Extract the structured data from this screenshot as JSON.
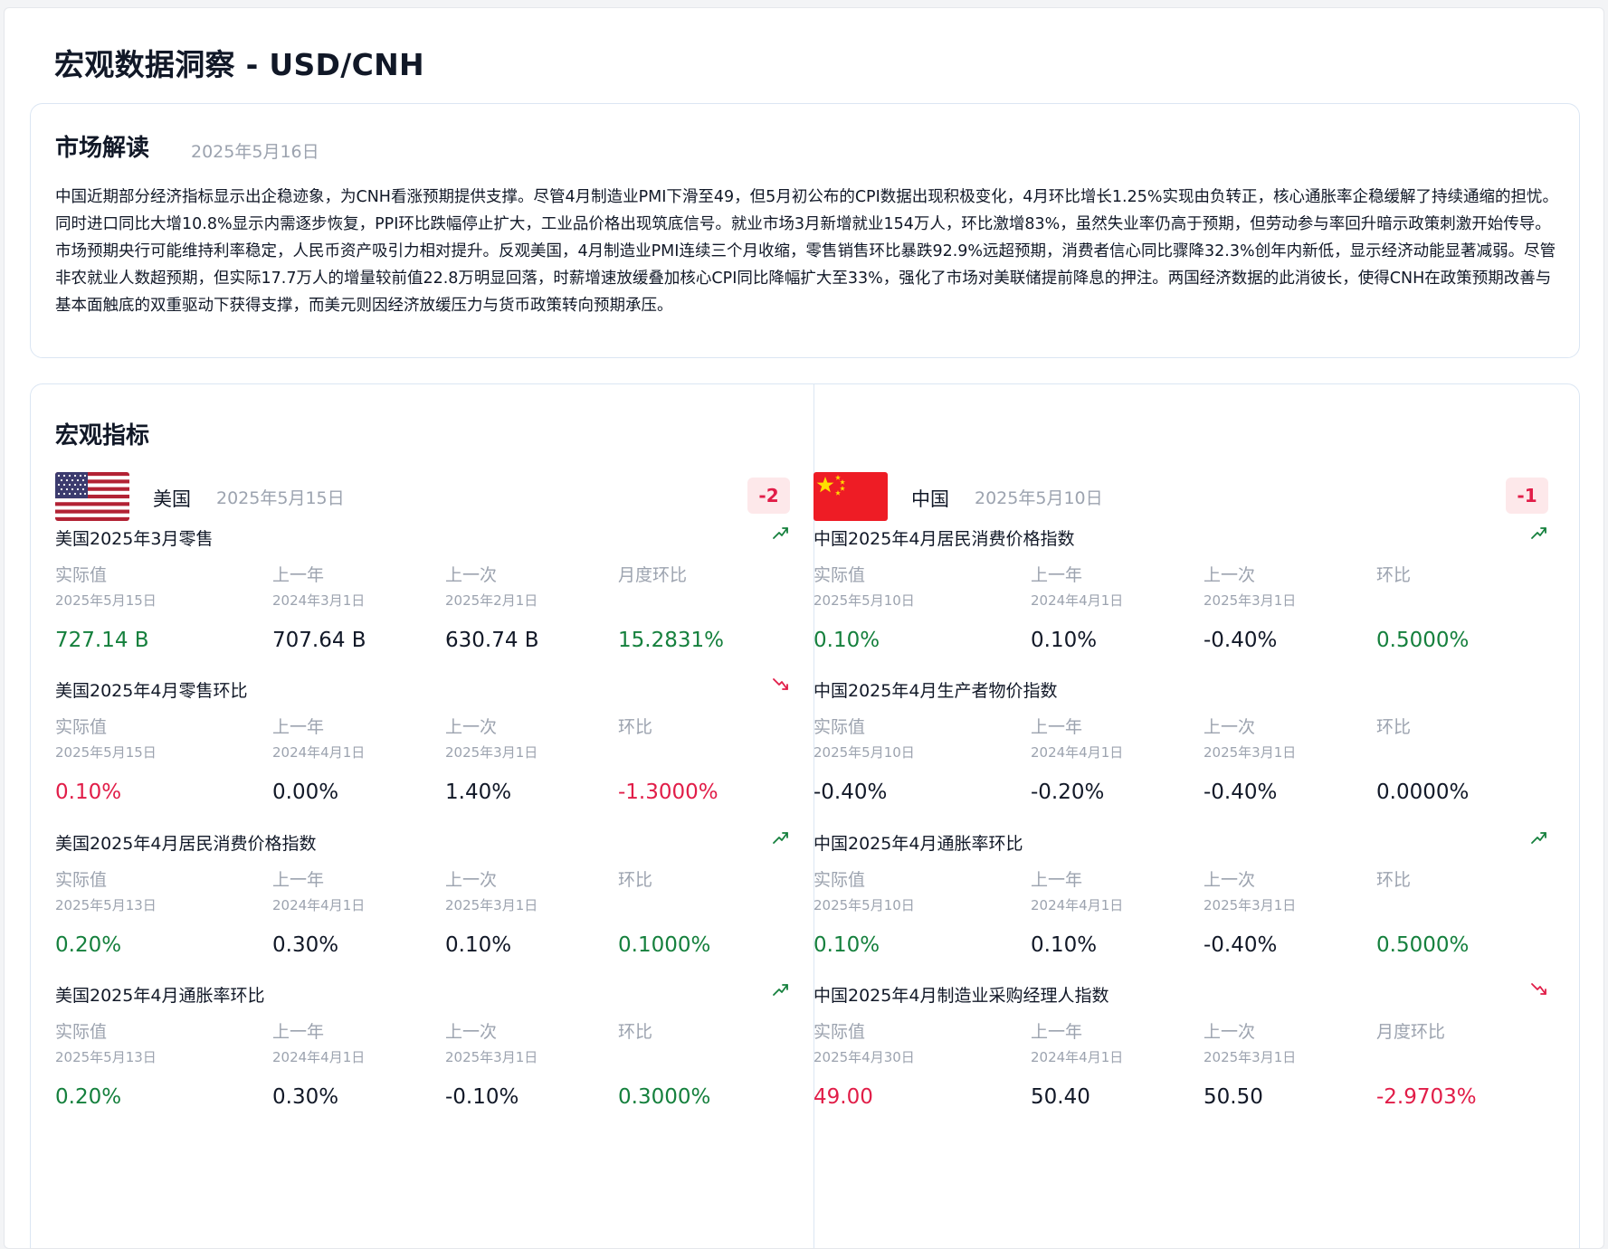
{
  "page": {
    "title": "宏观数据洞察 - USD/CNH"
  },
  "market": {
    "title": "市场解读",
    "date": "2025年5月16日",
    "text": "中国近期部分经济指标显示出企稳迹象，为CNH看涨预期提供支撑。尽管4月制造业PMI下滑至49，但5月初公布的CPI数据出现积极变化，4月环比增长1.25%实现由负转正，核心通胀率企稳缓解了持续通缩的担忧。同时进口同比大增10.8%显示内需逐步恢复，PPI环比跌幅停止扩大，工业品价格出现筑底信号。就业市场3月新增就业154万人，环比激增83%，虽然失业率仍高于预期，但劳动参与率回升暗示政策刺激开始传导。市场预期央行可能维持利率稳定，人民币资产吸引力相对提升。反观美国，4月制造业PMI连续三个月收缩，零售销售环比暴跌92.9%远超预期，消费者信心同比骤降32.3%创年内新低，显示经济动能显著减弱。尽管非农就业人数超预期，但实际17.7万人的增量较前值22.8万明显回落，时薪增速放缓叠加核心CPI同比降幅扩大至33%，强化了市场对美联储提前降息的押注。两国经济数据的此消彼长，使得CNH在政策预期改善与基本面触底的双重驱动下获得支撑，而美元则因经济放缓压力与货币政策转向预期承压。"
  },
  "macro": {
    "title": "宏观指标",
    "us": {
      "name": "美国",
      "flag_icon": "us-flag-icon",
      "date": "2025年5月15日",
      "score": "-2",
      "indicators": [
        {
          "name": "美国2025年3月零售",
          "trend": "up",
          "labels": [
            "实际值",
            "上一年",
            "上一次",
            "月度环比"
          ],
          "dates": [
            "2025年5月15日",
            "2024年3月1日",
            "2025年2月1日",
            ""
          ],
          "values": [
            "727.14 B",
            "707.64 B",
            "630.74 B",
            "15.2831%"
          ],
          "actual_sign": "pos",
          "change_sign": "pos"
        },
        {
          "name": "美国2025年4月零售环比",
          "trend": "down",
          "labels": [
            "实际值",
            "上一年",
            "上一次",
            "环比"
          ],
          "dates": [
            "2025年5月15日",
            "2024年4月1日",
            "2025年3月1日",
            ""
          ],
          "values": [
            "0.10%",
            "0.00%",
            "1.40%",
            "-1.3000%"
          ],
          "actual_sign": "neg",
          "change_sign": "neg"
        },
        {
          "name": "美国2025年4月居民消费价格指数",
          "trend": "up",
          "labels": [
            "实际值",
            "上一年",
            "上一次",
            "环比"
          ],
          "dates": [
            "2025年5月13日",
            "2024年4月1日",
            "2025年3月1日",
            ""
          ],
          "values": [
            "0.20%",
            "0.30%",
            "0.10%",
            "0.1000%"
          ],
          "actual_sign": "pos",
          "change_sign": "pos"
        },
        {
          "name": "美国2025年4月通胀率环比",
          "trend": "up",
          "labels": [
            "实际值",
            "上一年",
            "上一次",
            "环比"
          ],
          "dates": [
            "2025年5月13日",
            "2024年4月1日",
            "2025年3月1日",
            ""
          ],
          "values": [
            "0.20%",
            "0.30%",
            "-0.10%",
            "0.3000%"
          ],
          "actual_sign": "pos",
          "change_sign": "pos"
        }
      ]
    },
    "cn": {
      "name": "中国",
      "flag_icon": "china-flag-icon",
      "date": "2025年5月10日",
      "score": "-1",
      "indicators": [
        {
          "name": "中国2025年4月居民消费价格指数",
          "trend": "up",
          "labels": [
            "实际值",
            "上一年",
            "上一次",
            "环比"
          ],
          "dates": [
            "2025年5月10日",
            "2024年4月1日",
            "2025年3月1日",
            ""
          ],
          "values": [
            "0.10%",
            "0.10%",
            "-0.40%",
            "0.5000%"
          ],
          "actual_sign": "pos",
          "change_sign": "pos"
        },
        {
          "name": "中国2025年4月生产者物价指数",
          "trend": "none",
          "labels": [
            "实际值",
            "上一年",
            "上一次",
            "环比"
          ],
          "dates": [
            "2025年5月10日",
            "2024年4月1日",
            "2025年3月1日",
            ""
          ],
          "values": [
            "-0.40%",
            "-0.20%",
            "-0.40%",
            "0.0000%"
          ],
          "actual_sign": "neutral",
          "change_sign": "neutral"
        },
        {
          "name": "中国2025年4月通胀率环比",
          "trend": "up",
          "labels": [
            "实际值",
            "上一年",
            "上一次",
            "环比"
          ],
          "dates": [
            "2025年5月10日",
            "2024年4月1日",
            "2025年3月1日",
            ""
          ],
          "values": [
            "0.10%",
            "0.10%",
            "-0.40%",
            "0.5000%"
          ],
          "actual_sign": "pos",
          "change_sign": "pos"
        },
        {
          "name": "中国2025年4月制造业采购经理人指数",
          "trend": "down",
          "labels": [
            "实际值",
            "上一年",
            "上一次",
            "月度环比"
          ],
          "dates": [
            "2025年4月30日",
            "2024年4月1日",
            "2025年3月1日",
            ""
          ],
          "values": [
            "49.00",
            "50.40",
            "50.50",
            "-2.9703%"
          ],
          "actual_sign": "neg",
          "change_sign": "neg"
        }
      ]
    }
  },
  "colors": {
    "positive": "#15803d",
    "negative": "#e11d48",
    "muted": "#9ca3af",
    "badge_bg": "#fde8ea"
  }
}
